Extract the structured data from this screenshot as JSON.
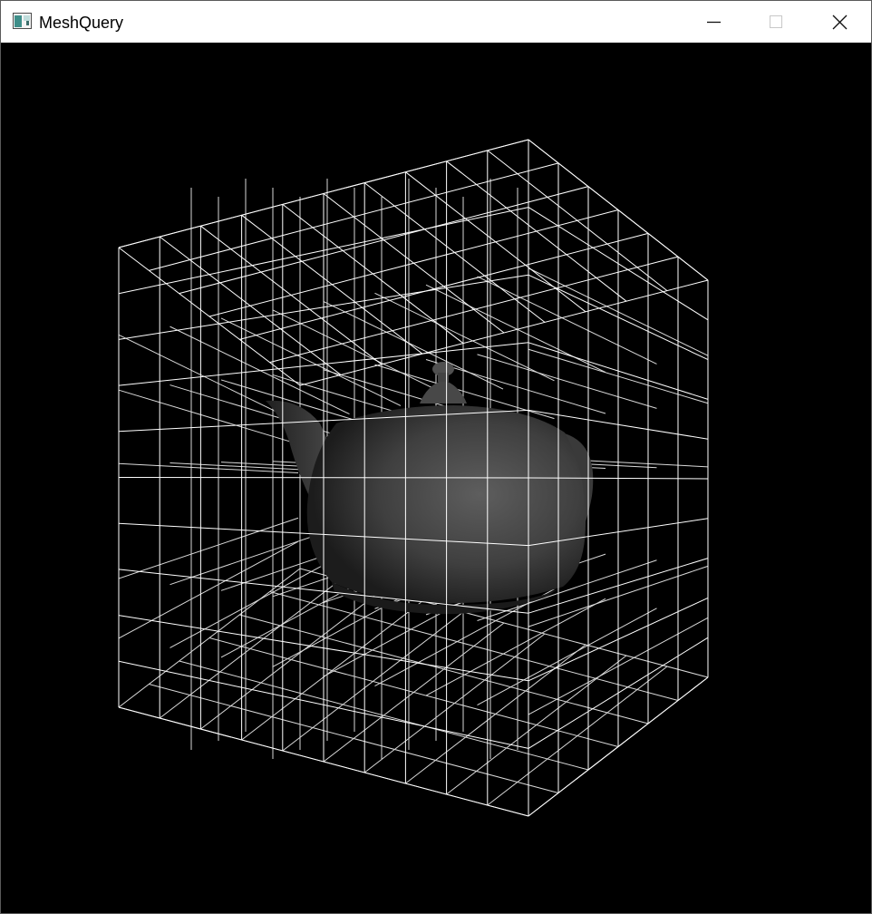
{
  "window": {
    "title": "MeshQuery",
    "icon": "application-window-icon",
    "controls": [
      "minimize-icon",
      "maximize-icon",
      "close-icon"
    ]
  },
  "scene": {
    "background": "#000000",
    "grid_color": "#ffffff",
    "mesh_color": "#4a4a4a"
  }
}
